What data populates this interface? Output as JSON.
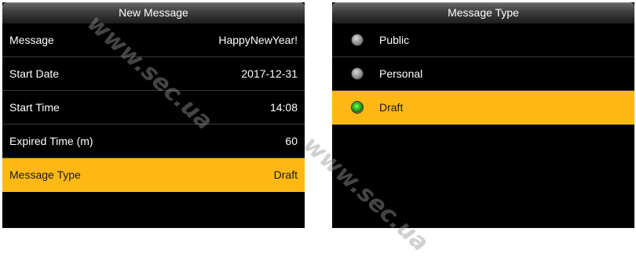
{
  "left_screen": {
    "title": "New Message",
    "rows": [
      {
        "label": "Message",
        "value": "HappyNewYear!"
      },
      {
        "label": "Start Date",
        "value": "2017-12-31"
      },
      {
        "label": "Start Time",
        "value": "14:08"
      },
      {
        "label": "Expired Time (m)",
        "value": "60"
      },
      {
        "label": "Message Type",
        "value": "Draft"
      }
    ]
  },
  "right_screen": {
    "title": "Message Type",
    "options": [
      {
        "label": "Public"
      },
      {
        "label": "Personal"
      },
      {
        "label": "Draft"
      }
    ]
  },
  "watermark": "www.sec.ua",
  "colors": {
    "highlight": "#fdb814",
    "screen_bg": "#000000",
    "radio_checked": "#2fbf1d"
  }
}
